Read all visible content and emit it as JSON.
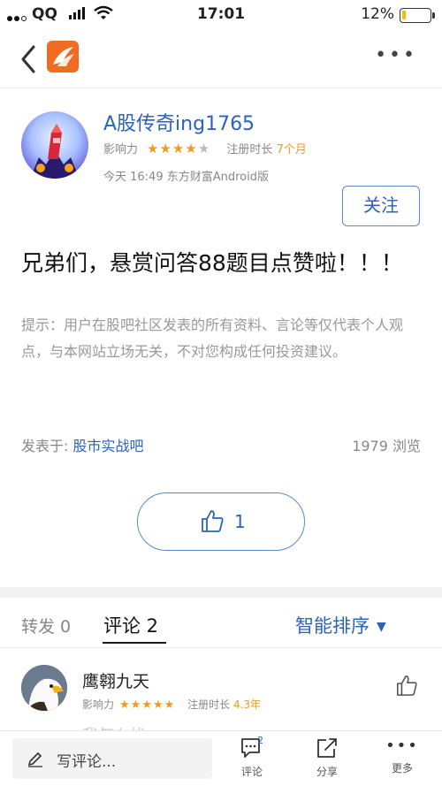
{
  "status_bar": {
    "carrier": "QQ",
    "time": "17:01",
    "battery": "12%"
  },
  "nav": {
    "back_icon": "chevron-left-icon",
    "app_icon": "eastmoney-logo-icon",
    "more_icon": "more-horizontal-icon"
  },
  "post": {
    "author": "A股传奇ing1765",
    "influence_label": "影响力",
    "influence_stars": 4,
    "reg_label": "注册时长",
    "reg_value": "7个月",
    "timestamp": "今天 16:49 东方财富Android版",
    "follow_label": "关注",
    "title": "兄弟们，悬赏问答88题目点赞啦！！！",
    "disclaimer": "提示：用户在股吧社区发表的所有资料、言论等仅代表个人观点，与本网站立场无关，不对您构成任何投资建议。",
    "posted_in_label": "发表于:",
    "posted_in_bar": "股市实战吧",
    "views": "1979 浏览",
    "like_count": "1"
  },
  "tabs": {
    "repost_label": "转发 0",
    "comment_label": "评论 2",
    "sort_label": "智能排序"
  },
  "comments": [
    {
      "name": "鹰翱九天",
      "influence_label": "影响力",
      "influence_stars": 5,
      "reg_label": "注册时长",
      "reg_value": "4.3年",
      "partial_text": "我怎么找"
    }
  ],
  "bottom_bar": {
    "write_placeholder": "写评论...",
    "comment_label": "评论",
    "comment_badge": "2",
    "share_label": "分享",
    "more_label": "更多"
  },
  "colors": {
    "accent_blue": "#2b63b8",
    "star_orange": "#f29a1e",
    "brand_orange": "#f26b22"
  }
}
